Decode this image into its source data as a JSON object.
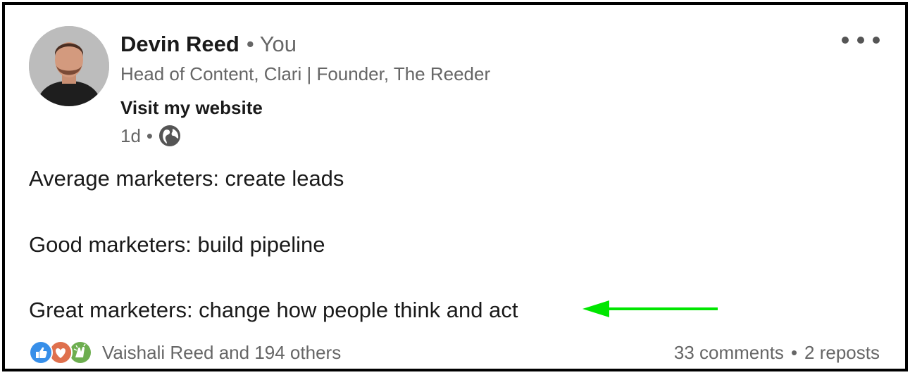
{
  "post": {
    "author": {
      "name": "Devin Reed",
      "relation": "You",
      "headline": "Head of Content, Clari | Founder, The Reeder",
      "link_label": "Visit my website"
    },
    "meta": {
      "age": "1d",
      "visibility_icon": "globe-icon"
    },
    "more_icon": "ellipsis-icon",
    "body_lines": [
      "Average marketers: create leads",
      "Good marketers: build pipeline",
      "Great marketers: change how people think and act"
    ],
    "annotation": {
      "icon": "arrow-left",
      "color": "#00e600"
    },
    "reactions": {
      "icons": [
        "like-icon",
        "love-icon",
        "celebrate-icon"
      ],
      "summary": "Vaishali Reed and 194 others"
    },
    "social_counts": {
      "comments": "33 comments",
      "reposts": "2 reposts"
    }
  }
}
